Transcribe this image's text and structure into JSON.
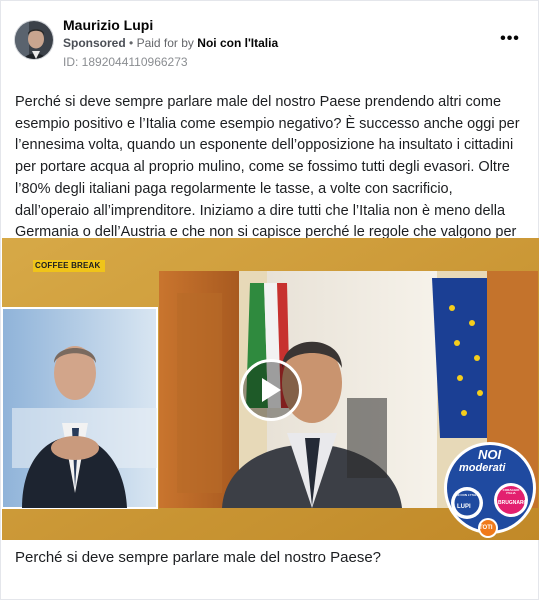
{
  "post": {
    "author": "Maurizio Lupi",
    "sponsored": "Sponsored",
    "paid_for_prefix": "Paid for by",
    "payer": "Noi con l'Italia",
    "ad_id": "ID: 1892044110966273",
    "body": "Perché si deve sempre parlare male del nostro Paese prendendo altri come esempio positivo e l’Italia come esempio negativo? È successo anche oggi per l’ennesima volta, quando un esponente dell’opposizione ha insultato i cittadini per portare acqua al proprio mulino, come se fossimo tutti degli evasori. Oltre l’80% degli italiani paga regolarmente le tasse, a volte con sacrificio, dall’operaio all’imprenditore. Iniziamo a dire tutti che l’Italia non è meno della Germania o dell’Austria e che non si capisce perché le regole che valgono per loro non…",
    "caption": "Perché si deve sempre parlare male del nostro Paese?",
    "more_icon": "more-options-icon"
  },
  "video": {
    "banner": "COFFEE BREAK",
    "logo_top": "NOI",
    "logo_main": "moderati",
    "logo_left": "LUPI",
    "logo_left_sub": "NOI CON L'ITALIA",
    "logo_bottom": "TOTI",
    "logo_right": "BRUGNARO",
    "logo_right_sub": "CORAGGIO ITALIA",
    "play_icon": "play-icon",
    "colors": {
      "frame": "#d9a53c",
      "logo_blue": "#1f4aa0",
      "logo_pink": "#e3206f"
    }
  }
}
